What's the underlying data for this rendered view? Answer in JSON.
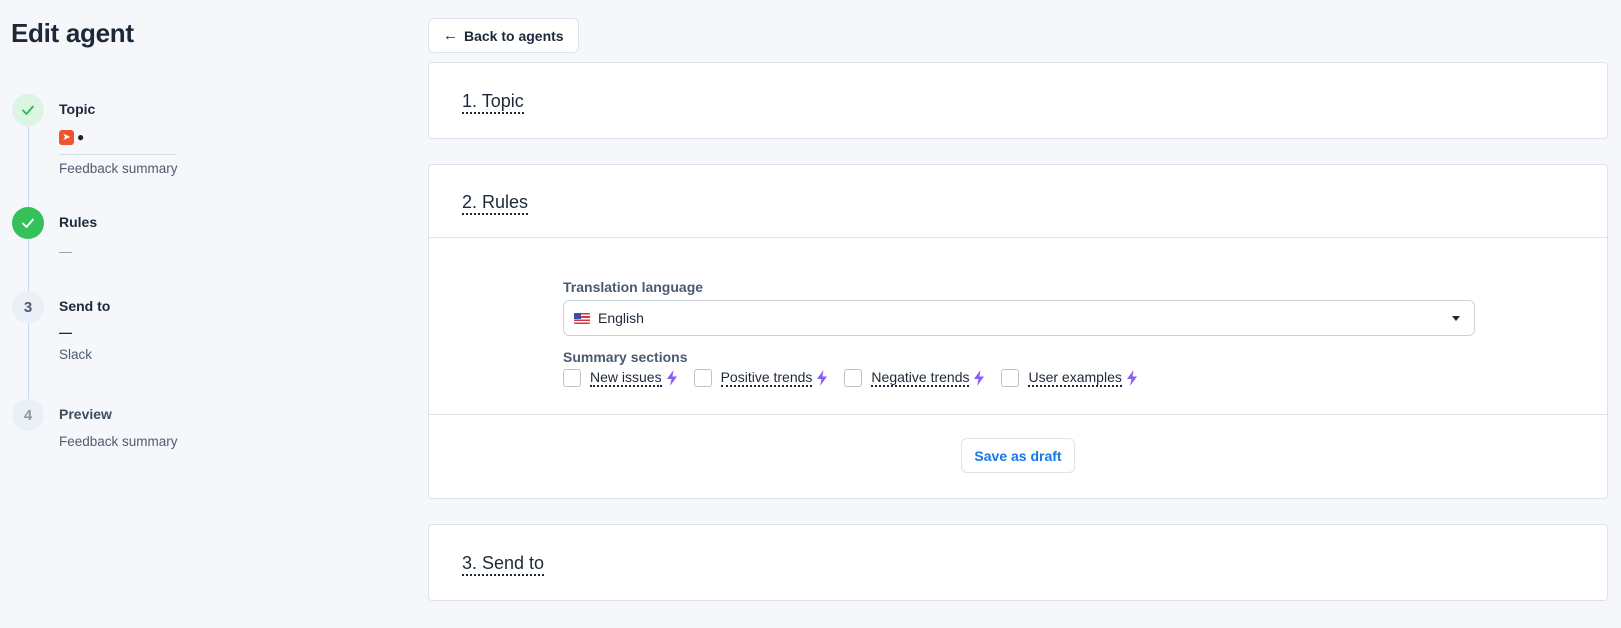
{
  "page": {
    "title": "Edit agent"
  },
  "stepper": {
    "steps": [
      {
        "status": "done",
        "title": "Topic",
        "subtitle": "Feedback summary"
      },
      {
        "status": "done",
        "title": "Rules",
        "subtitle": "—"
      },
      {
        "number": "3",
        "title": "Send to",
        "dash": "—",
        "subtitle": "Slack"
      },
      {
        "number": "4",
        "title": "Preview",
        "subtitle": "Feedback summary"
      }
    ],
    "sources": [
      "app-source-icon",
      "apple-icon"
    ]
  },
  "back_button": {
    "label": "Back to agents",
    "icon": "arrow-left-icon"
  },
  "sections": {
    "topic": {
      "title": "1. Topic"
    },
    "rules": {
      "title": "2. Rules",
      "translation_label": "Translation language",
      "translation_value": "English",
      "summary_label": "Summary sections",
      "checkboxes": [
        {
          "label": "New issues",
          "checked": false
        },
        {
          "label": "Positive trends",
          "checked": false
        },
        {
          "label": "Negative trends",
          "checked": false
        },
        {
          "label": "User examples",
          "checked": false
        }
      ],
      "save_label": "Save as draft"
    },
    "send_to": {
      "title": "3. Send to"
    }
  },
  "colors": {
    "accent": "#1478e8",
    "success": "#35c15a",
    "ai_bolt": "#8b5cf6"
  }
}
